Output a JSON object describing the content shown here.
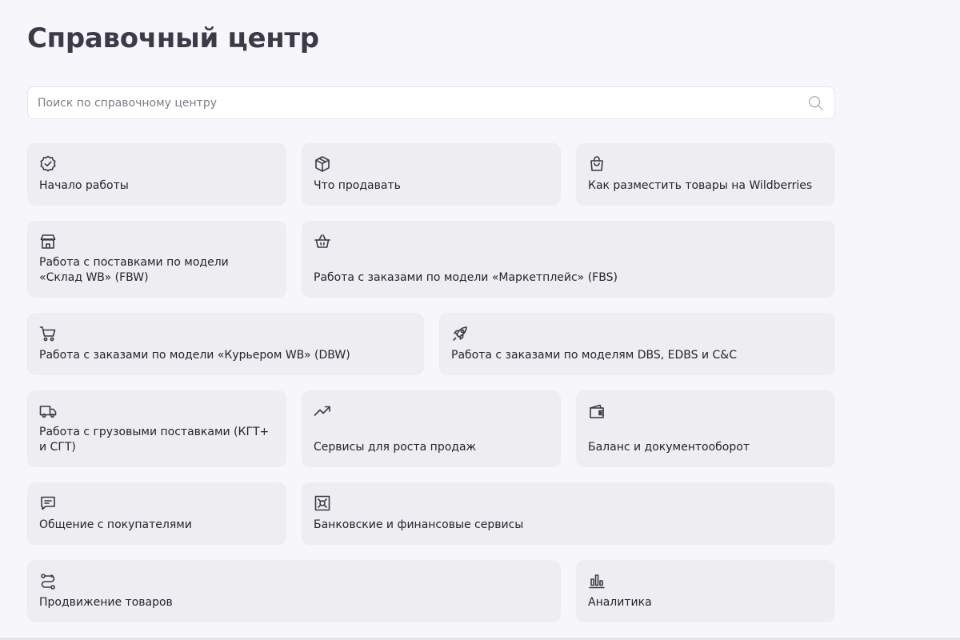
{
  "header": {
    "title": "Справочный центр"
  },
  "search": {
    "placeholder": "Поиск по справочному центру",
    "value": "",
    "icon": "search-icon"
  },
  "colors": {
    "background": "#f7f7fb",
    "tile": "#ededf2",
    "title": "#3b3b47",
    "text": "#24242b",
    "icon": "#3a3a45"
  },
  "categories": [
    {
      "label": "Начало работы",
      "icon": "badge-check-icon"
    },
    {
      "label": "Что продавать",
      "icon": "box-icon"
    },
    {
      "label": "Как разместить товары на Wildberries",
      "icon": "shopping-bag-icon"
    },
    {
      "label": "Работа с поставками по модели «Склад WB» (FBW)",
      "icon": "warehouse-icon"
    },
    {
      "label": "Работа с заказами по модели «Маркетплейс» (FBS)",
      "icon": "basket-icon"
    },
    {
      "label": "Работа с заказами по модели «Курьером WB» (DBW)",
      "icon": "cart-icon"
    },
    {
      "label": "Работа с заказами по моделям DBS, EDBS и C&C",
      "icon": "rocket-icon"
    },
    {
      "label": "Работа с грузовыми поставками (КГТ+ и СГТ)",
      "icon": "truck-icon"
    },
    {
      "label": "Сервисы для роста продаж",
      "icon": "trending-up-icon"
    },
    {
      "label": "Баланс и документооборот",
      "icon": "wallet-icon"
    },
    {
      "label": "Общение с покупателями",
      "icon": "chat-icon"
    },
    {
      "label": "Банковские и финансовые сервисы",
      "icon": "safe-icon"
    },
    {
      "label": "Продвижение товаров",
      "icon": "route-icon"
    },
    {
      "label": "Аналитика",
      "icon": "bar-chart-icon"
    }
  ]
}
